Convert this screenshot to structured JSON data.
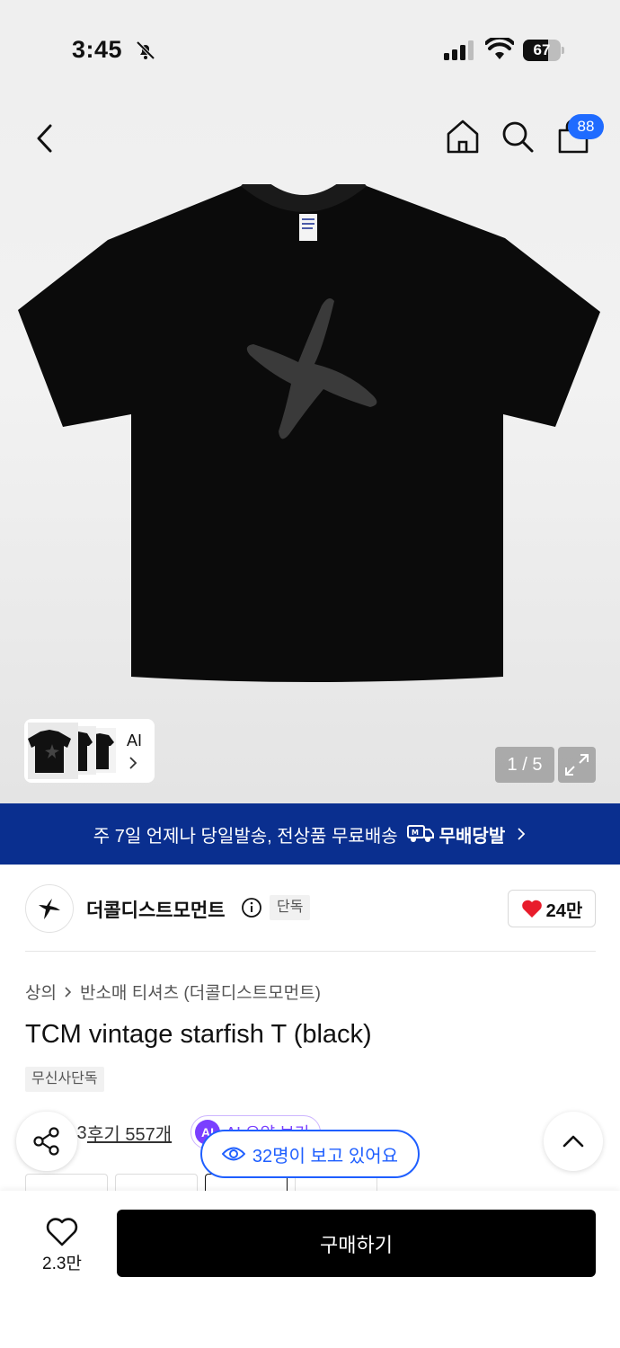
{
  "status_bar": {
    "time": "3:45",
    "battery": "67",
    "battery_level": 0.67
  },
  "header": {
    "cart_count": "88"
  },
  "gallery": {
    "thumbnail_label": "AI",
    "counter": "1 / 5",
    "shirt_color": "#0b0b0b",
    "print_color": "#3a3a3a"
  },
  "banner": {
    "text": "주 7일 언제나 당일발송, 전상품 무료배송",
    "service_name": "무배당발",
    "bg_color": "#0a2f8f"
  },
  "brand": {
    "name": "더콜디스트모먼트",
    "exclusive_badge": "단독",
    "like_count": "24만"
  },
  "breadcrumb": {
    "category": "상의",
    "subcategory": "반소매 티셔츠 (더콜디스트모먼트)"
  },
  "product": {
    "title": "TCM vintage starfish T (black)",
    "store_badge": "무신사단독"
  },
  "reviews": {
    "rating_partial": ".3",
    "review_link": "후기 557개",
    "ai_icon": "AI",
    "ai_summary": "AI 요약 보기"
  },
  "viewers": {
    "text": "32명이 보고 있어요",
    "accent": "#1f5fff"
  },
  "bottom_bar": {
    "wish_count": "2.3만",
    "buy_label": "구매하기"
  }
}
